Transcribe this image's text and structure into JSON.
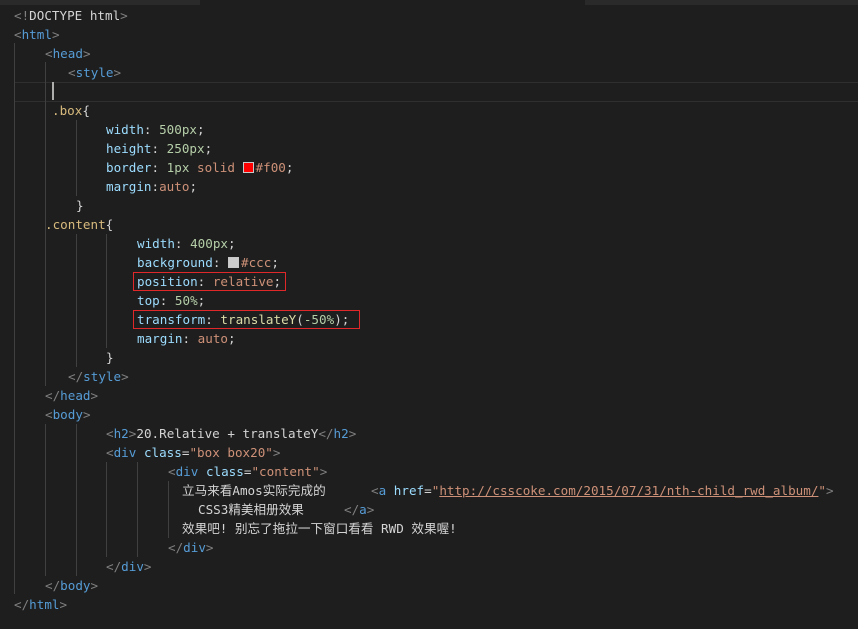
{
  "colors": {
    "background": "#1e1e1e",
    "tag": "#569cd6",
    "bracket": "#808080",
    "selector": "#d7ba7d",
    "property": "#9cdcfe",
    "number": "#b5cea8",
    "string_value": "#ce9178",
    "text": "#d4d4d4",
    "highlight_box": "#e0282b"
  },
  "code": {
    "doctype": {
      "open": "<!",
      "name": "DOCTYPE",
      "rest": " html",
      "close": ">"
    },
    "html_open": "html",
    "head_open": "head",
    "style_open": "style",
    "box_selector": ".box",
    "box_brace": "{",
    "box_width_prop": "width",
    "box_width_val": "500px",
    "box_height_prop": "height",
    "box_height_val": "250px",
    "box_border_prop": "border",
    "box_border_num": "1px",
    "box_border_kw": "solid",
    "box_border_color": "#f00",
    "box_margin_prop": "margin",
    "box_margin_val": "auto",
    "close_brace": "}",
    "content_selector": ".content",
    "content_brace": "{",
    "content_width_prop": "width",
    "content_width_val": "400px",
    "content_bg_prop": "background",
    "content_bg_color": "#ccc",
    "content_pos_prop": "position",
    "content_pos_val": "relative",
    "content_top_prop": "top",
    "content_top_val": "50%",
    "content_transform_prop": "transform",
    "content_transform_fn": "translateY",
    "content_transform_num": "-50%",
    "content_margin_prop": "margin",
    "content_margin_val": "auto",
    "style_close": "style",
    "head_close": "head",
    "body_open": "body",
    "h2_tag": "h2",
    "h2_text": "20.Relative + translateY",
    "div_tag": "div",
    "class_attr": "class",
    "div_class_val": "\"box box20\"",
    "content_div_class_val": "\"content\"",
    "p_text_1": "立马来看Amos实际完成的",
    "a_tag": "a",
    "href_attr": "href",
    "href_val_q1": "\"",
    "href_url": "http://csscoke.com/2015/07/31/nth-child_rwd_album/",
    "href_val_q2": "\"",
    "p_text_2": "CSS3精美相册效果",
    "p_text_3": "效果吧! 别忘了拖拉一下窗口看看 RWD 效果喔!",
    "body_close": "body",
    "html_close": "html"
  }
}
